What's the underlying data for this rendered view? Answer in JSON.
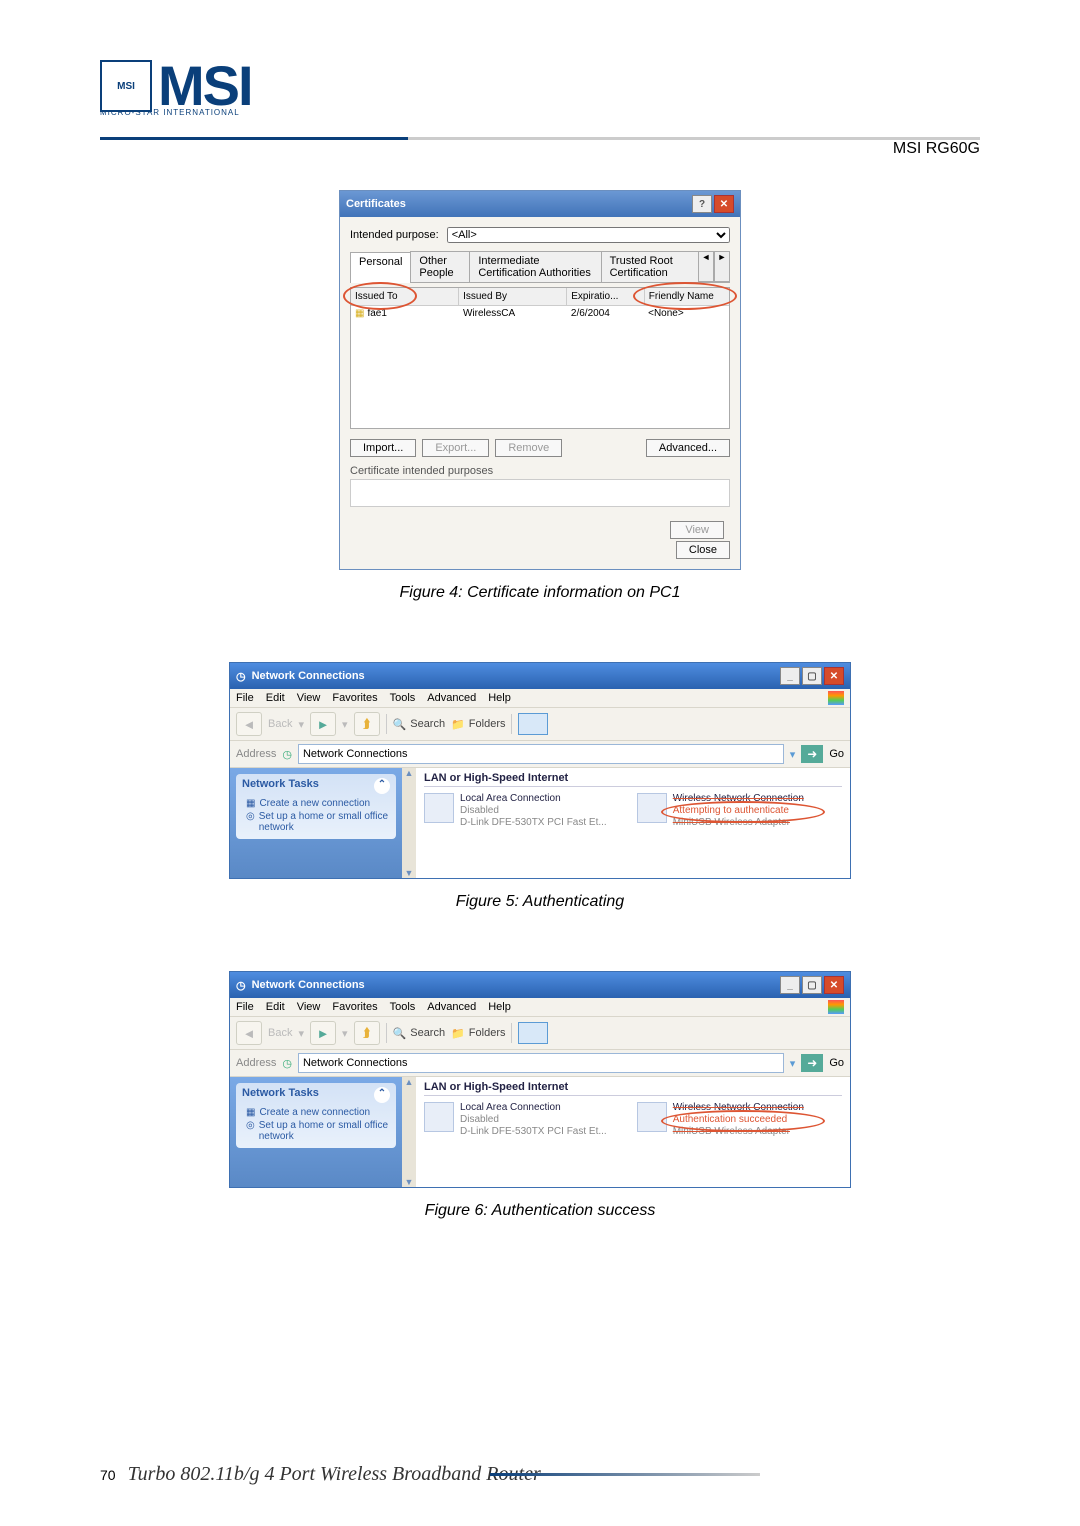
{
  "header": {
    "logo_badge": "MSI",
    "logo_text": "MSI",
    "logo_sub": "MICRO-STAR INTERNATIONAL",
    "title": "MSI RG60G"
  },
  "cert": {
    "window_title": "Certificates",
    "intended_purpose_label": "Intended purpose:",
    "intended_purpose_value": "<All>",
    "tabs": [
      "Personal",
      "Other People",
      "Intermediate Certification Authorities",
      "Trusted Root Certification"
    ],
    "cols": [
      "Issued To",
      "Issued By",
      "Expiratio...",
      "Friendly Name"
    ],
    "row": {
      "issued_to": "fae1",
      "issued_by": "WirelessCA",
      "exp": "2/6/2004",
      "friendly": "<None>"
    },
    "buttons": {
      "import": "Import...",
      "export": "Export...",
      "remove": "Remove",
      "advanced": "Advanced...",
      "view": "View",
      "close": "Close"
    },
    "purposes_label": "Certificate intended purposes"
  },
  "captions": {
    "f4": "Figure 4: Certificate information on PC1",
    "f5": "Figure 5: Authenticating",
    "f6": "Figure 6: Authentication success"
  },
  "nc": {
    "title": "Network Connections",
    "menu": [
      "File",
      "Edit",
      "View",
      "Favorites",
      "Tools",
      "Advanced",
      "Help"
    ],
    "toolbar": {
      "back": "Back",
      "search": "Search",
      "folders": "Folders"
    },
    "address_label": "Address",
    "address_value": "Network Connections",
    "go": "Go",
    "side_panel": {
      "title": "Network Tasks",
      "items": [
        "Create a new connection",
        "Set up a home or small office network"
      ]
    },
    "lan_header": "LAN or High-Speed Internet",
    "conn1": {
      "name": "Local Area Connection",
      "status": "Disabled",
      "device": "D-Link DFE-530TX PCI Fast Et..."
    },
    "conn2_auth": {
      "name": "Wireless Network Connection",
      "status": "Attempting to authenticate",
      "device": "MiniUSB Wireless Adapter"
    },
    "conn2_succ": {
      "name": "Wireless Network Connection",
      "status": "Authentication succeeded",
      "device": "MiniUSB Wireless Adapter"
    }
  },
  "footer": {
    "page_no": "70",
    "text": "Turbo 802.11b/g 4 Port Wireless Broadband Router"
  }
}
